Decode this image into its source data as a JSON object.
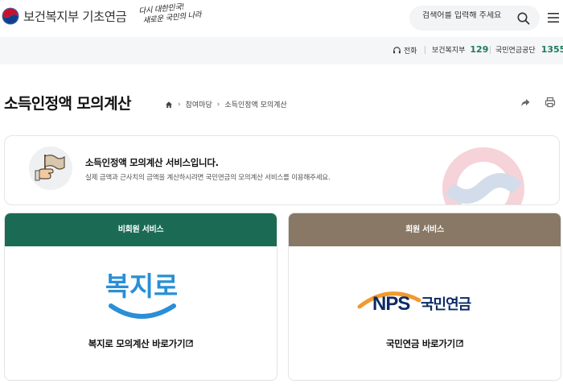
{
  "header": {
    "logo_text": "보건복지부 기초연금",
    "slogan_line1": "다시 대한민국!",
    "slogan_line2": "새로운 국민의 나라",
    "search_placeholder": "검색어를 입력해 주세요",
    "icons": {
      "emblem": "government-emblem-icon",
      "search": "search-icon",
      "menu": "hamburger-menu-icon"
    }
  },
  "contact": {
    "phone_label": "전화",
    "items": [
      {
        "name": "보건복지부",
        "number": "129"
      },
      {
        "name": "국민연금공단",
        "number": "1355"
      }
    ],
    "icons": {
      "phone": "headset-icon"
    }
  },
  "page": {
    "title": "소득인정액 모의계산",
    "breadcrumb": [
      "참여마당",
      "소득인정액 모의계산"
    ],
    "icons": {
      "home": "home-icon",
      "share": "share-icon",
      "print": "print-icon"
    }
  },
  "info": {
    "title": "소득인정액 모의계산 서비스입니다.",
    "description": "실제 금액과 근사치의 금액을 계산하시려면 국민연금의 모의계산 서비스를 이용해주세요.",
    "icons": {
      "illustration": "hand-flag-icon"
    }
  },
  "cards": [
    {
      "header": "비회원 서비스",
      "logo": "복지로",
      "link": "복지로 모의계산 바로가기"
    },
    {
      "header": "회원 서비스",
      "logo_nps": "NPS",
      "logo_text": "국민연금",
      "link": "국민연금 바로가기"
    }
  ],
  "colors": {
    "green": "#1b6b54",
    "brown": "#8a7866",
    "accent_number": "#1d7a5a",
    "bokjiro_blue": "#2a8fd6"
  }
}
